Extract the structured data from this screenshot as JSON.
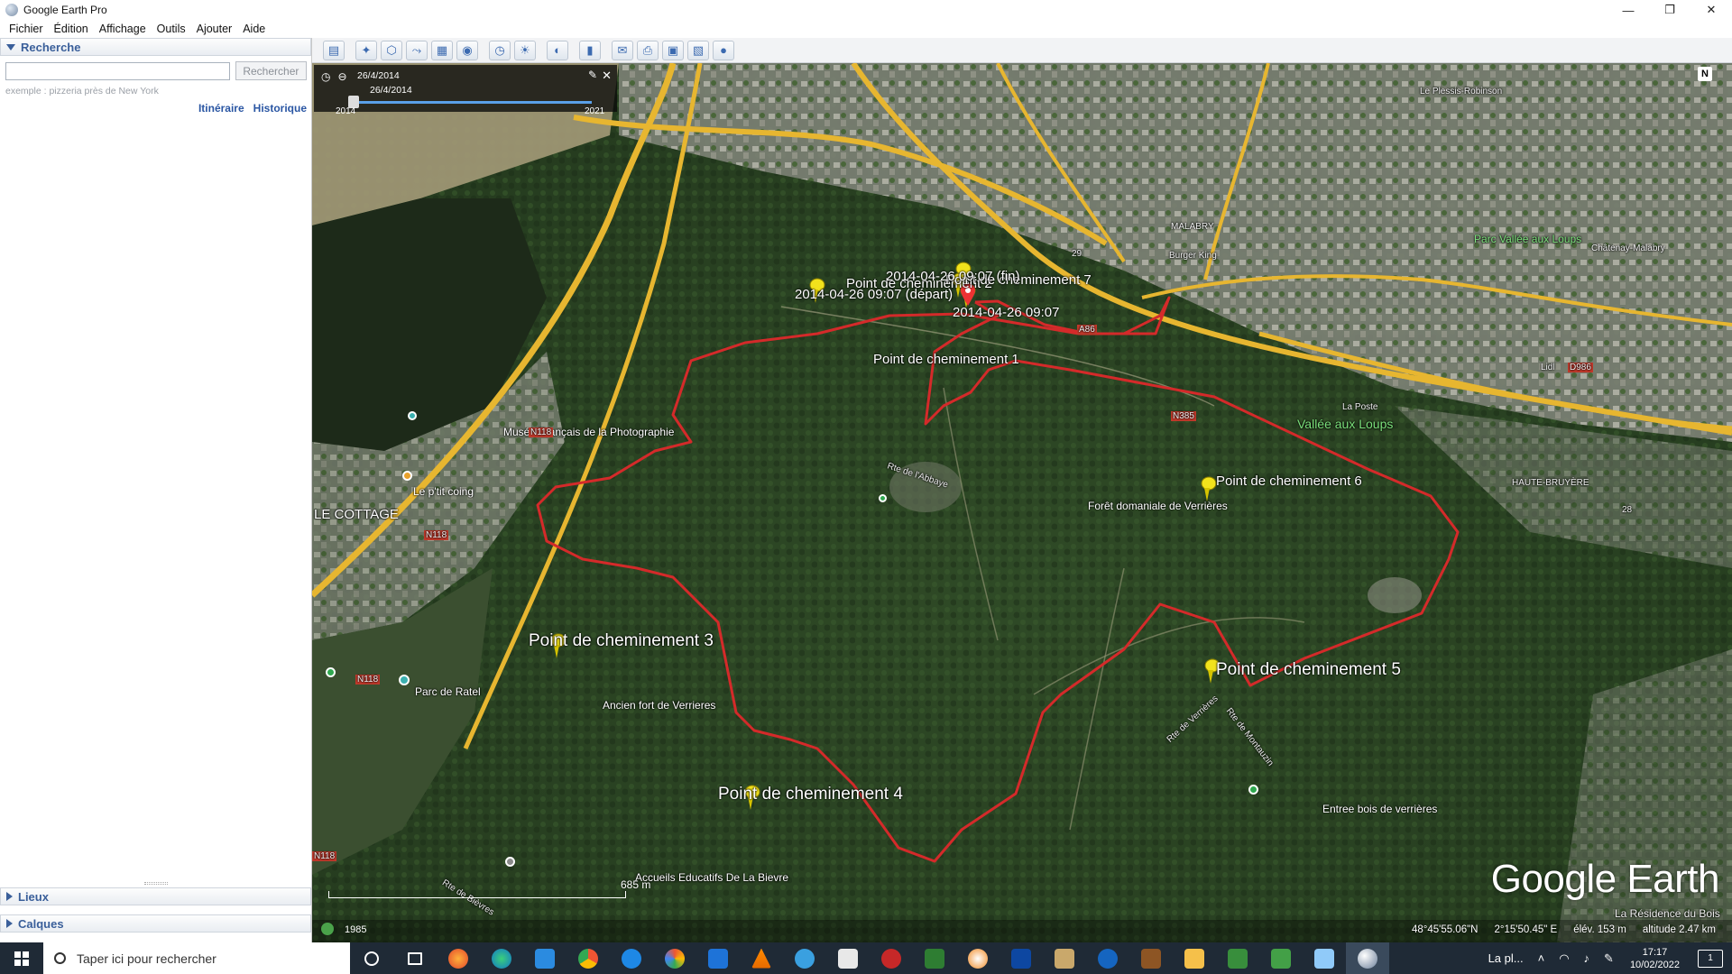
{
  "window": {
    "title": "Google Earth Pro",
    "minimize": "—",
    "maximize": "❐",
    "close": "✕"
  },
  "menu": [
    "Fichier",
    "Édition",
    "Affichage",
    "Outils",
    "Ajouter",
    "Aide"
  ],
  "search": {
    "header": "Recherche",
    "input_value": "",
    "button": "Rechercher",
    "hint": "exemple : pizzeria près de New York",
    "link_itinerary": "Itinéraire",
    "link_history": "Historique"
  },
  "panels": {
    "places": "Lieux",
    "layers": "Calques"
  },
  "toolbar_icons": [
    "sidebar-icon",
    "placemark-icon",
    "polygon-icon",
    "path-icon",
    "image-overlay-icon",
    "record-tour-icon",
    "historical-imagery-icon",
    "sun-icon",
    "planets-icon",
    "ruler-icon",
    "email-icon",
    "print-icon",
    "save-image-icon",
    "view-in-maps-icon",
    "earth-icon"
  ],
  "time_slider": {
    "date_top": "26/4/2014",
    "date_bottom": "26/4/2014",
    "year_start": "2014",
    "year_end": "2021"
  },
  "map_labels": {
    "wp2": "Point de cheminement 2",
    "wp7": "Point de cheminement 7",
    "wp1": "Point de cheminement 1",
    "wp3": "Point de cheminement 3",
    "wp4": "Point de cheminement 4",
    "wp5": "Point de cheminement 5",
    "wp6": "Point de cheminement 6",
    "end_time": "2014-04-26 09:07 (fin)",
    "start_time": "2014-04-26 09:07 (départ)",
    "time_short": "2014-04-26 09:07",
    "musee": "Musée Français de la Photographie",
    "petit_coing": "Le p'tit coing",
    "cottage": "LE COTTAGE",
    "n118a": "N118",
    "n118b": "N118",
    "n118c": "N118",
    "n118d": "N118",
    "foret": "Forêt domaniale de Verrières",
    "parc_ratel": "Parc de Ratel",
    "fort": "Ancien fort de Verrieres",
    "accueils": "Accueils Educatifs De La Bievre",
    "entree": "Entree bois de verrières",
    "vallee": "Vallée aux Loups",
    "laposte": "La Poste",
    "malabry": "MALABRY",
    "parc_vallee": "Parc Vallée aux Loups",
    "chatenay": "Châtenay-Malabry",
    "plessis": "Le Plessis-Robinson",
    "residence": "La Résidence du Bois",
    "rte_abbaye": "Rte de l'Abbaye",
    "rte_verrieres": "Rte de Verrières",
    "rte_montauzin": "Rte de Montauzin",
    "rte_bievres": "Rte de Bièvres",
    "a86": "A86",
    "n385": "N385",
    "d986": "D986",
    "lidl": "Lidl",
    "burger": "Burger King",
    "hautes_bruyeres": "HAUTE-BRUYÈRE",
    "road28": "28",
    "road29": "29"
  },
  "status": {
    "scale": "685 m",
    "year": "1985",
    "lat": "48°45'55.06\"N",
    "lon": "2°15'50.45\" E",
    "elev": "élév.  153 m",
    "alt": "altitude   2.47 km"
  },
  "logo": "Google Earth",
  "compass": "N",
  "taskbar": {
    "search_placeholder": "Taper ici pour rechercher",
    "weather": "La pl...",
    "time": "17:17",
    "date": "10/02/2022",
    "notifications": "1"
  },
  "colors": {
    "track": "#d42a2a",
    "pin": "#f2e21c",
    "road": "#f0c43a",
    "title_accent": "#3a5f9a"
  }
}
